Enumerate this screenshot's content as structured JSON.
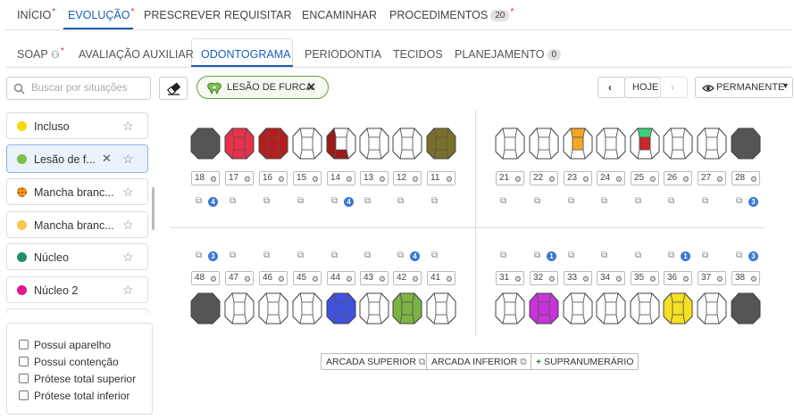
{
  "top_tabs": [
    {
      "label": "INÍCIO",
      "star": true
    },
    {
      "label": "EVOLUÇÃO",
      "star": true,
      "active": true
    },
    {
      "label": "PRESCREVER"
    },
    {
      "label": "REQUISITAR"
    },
    {
      "label": "ENCAMINHAR"
    },
    {
      "label": "PROCEDIMENTOS",
      "badge": "20",
      "star": true
    }
  ],
  "sub_tabs": [
    {
      "label": "SOAP",
      "star": true
    },
    {
      "label": "AVALIAÇÃO AUXILIAR"
    },
    {
      "label": "ODONTOGRAMA",
      "active": true
    },
    {
      "label": "PERIODONTIA"
    },
    {
      "label": "TECIDOS"
    },
    {
      "label": "PLANEJAMENTO",
      "badge": "0"
    }
  ],
  "toolbar": {
    "search_placeholder": "Buscar por situações",
    "filter_chip": "LESÃO DE FURCA",
    "today": "HOJE",
    "mode": "PERMANENTE"
  },
  "situations": [
    {
      "label": "Incluso",
      "color": "#f5d90a"
    },
    {
      "label": "Lesão de f...",
      "color": "#7cc04b",
      "selected": true
    },
    {
      "label": "Mancha branc...",
      "color": "#f39c12",
      "pattern": true
    },
    {
      "label": "Mancha branc...",
      "color": "#f9c74f"
    },
    {
      "label": "Núcleo",
      "color": "#21906a"
    },
    {
      "label": "Núcleo 2",
      "color": "#e0198a"
    }
  ],
  "checks": [
    "Possui aparelho",
    "Possui contenção",
    "Prótese total superior",
    "Prótese total inferior"
  ],
  "upper_right_quadrant": [
    "18",
    "17",
    "16",
    "15",
    "14",
    "13",
    "12",
    "11"
  ],
  "upper_left_quadrant": [
    "21",
    "22",
    "23",
    "24",
    "25",
    "26",
    "27",
    "28"
  ],
  "lower_right_quadrant": [
    "48",
    "47",
    "46",
    "45",
    "44",
    "43",
    "42",
    "41"
  ],
  "lower_left_quadrant": [
    "31",
    "32",
    "33",
    "34",
    "35",
    "36",
    "37",
    "38"
  ],
  "upper_counts": {
    "14": "4",
    "18": "4",
    "28": "3"
  },
  "lower_counts": {
    "48": "3",
    "42": "4",
    "32": "1",
    "36": "1",
    "38": "3"
  },
  "tooth_colors": {
    "18": "#555555",
    "17": "#e8314a",
    "16": "#b71c1c",
    "14": "partial-red",
    "11": "#7a6f2a",
    "23": "partial-orange",
    "25": "partial-green-red",
    "28": "#555555",
    "48": "#555555",
    "44": "#3f51e0",
    "42": "#7cb342",
    "32": "#c933d9",
    "36": "#f5e120",
    "38": "#555555"
  },
  "buttons": {
    "arcada_superior": "ARCADA SUPERIOR",
    "arcada_inferior": "ARCADA INFERIOR",
    "supranumerario": "SUPRANUMERÁRIO"
  }
}
